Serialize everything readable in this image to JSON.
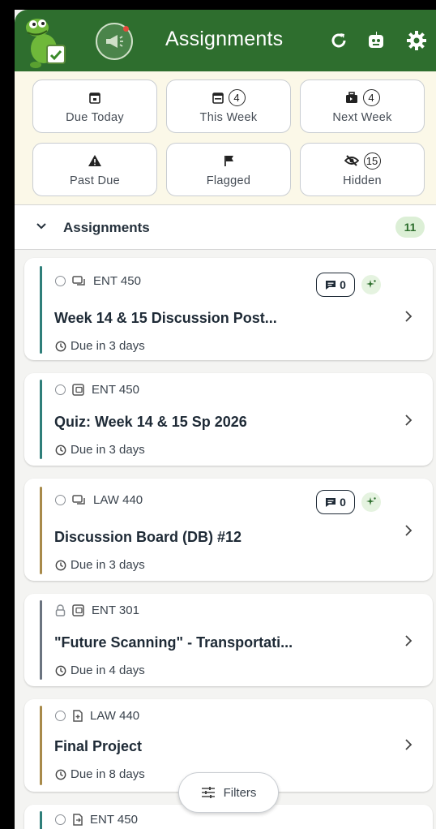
{
  "header": {
    "title": "Assignments",
    "icons": [
      "mascot-icon",
      "megaphone-icon",
      "refresh-icon",
      "robot-icon",
      "gear-icon"
    ],
    "colors": {
      "header_bg": "#2e6e2e",
      "tiles_bg": "#fbf8e8",
      "accent_green": "#2e6e2e"
    }
  },
  "tiles": [
    {
      "label": "Due Today",
      "icon": "calendar-today-icon",
      "count": null
    },
    {
      "label": "This Week",
      "icon": "calendar-week-icon",
      "count": "4"
    },
    {
      "label": "Next Week",
      "icon": "briefcase-icon",
      "count": "4"
    },
    {
      "label": "Past Due",
      "icon": "warning-icon",
      "count": null
    },
    {
      "label": "Flagged",
      "icon": "flag-icon",
      "count": null
    },
    {
      "label": "Hidden",
      "icon": "eye-off-icon",
      "count": "15"
    }
  ],
  "section": {
    "title": "Assignments",
    "count": "11"
  },
  "cards": [
    {
      "course": "ENT 450",
      "type_icon": "discussion-icon",
      "title": "Week 14 & 15 Discussion Post...",
      "due": "Due in 3 days",
      "comments": "0",
      "bar_color": "#2f7f7a",
      "locked": false
    },
    {
      "course": "ENT 450",
      "type_icon": "quiz-icon",
      "title": "Quiz: Week 14 & 15 Sp 2026",
      "due": "Due in 3 days",
      "comments": null,
      "bar_color": "#2f7f7a",
      "locked": false
    },
    {
      "course": "LAW 440",
      "type_icon": "discussion-icon",
      "title": "Discussion Board (DB) #12",
      "due": "Due in 3 days",
      "comments": "0",
      "bar_color": "#a88a4a",
      "locked": false
    },
    {
      "course": "ENT 301",
      "type_icon": "quiz-icon",
      "title": "\"Future Scanning\" - Transportati...",
      "due": "Due in 4 days",
      "comments": null,
      "bar_color": "#6b7480",
      "locked": true
    },
    {
      "course": "LAW 440",
      "type_icon": "assignment-icon",
      "title": "Final Project",
      "due": "Due in 8 days",
      "comments": null,
      "bar_color": "#a88a4a",
      "locked": false
    },
    {
      "course": "ENT 450",
      "type_icon": "assignment-icon",
      "title": "",
      "due": "",
      "comments": null,
      "bar_color": "#2f7f7a",
      "locked": false
    }
  ],
  "filters_button": {
    "label": "Filters"
  }
}
